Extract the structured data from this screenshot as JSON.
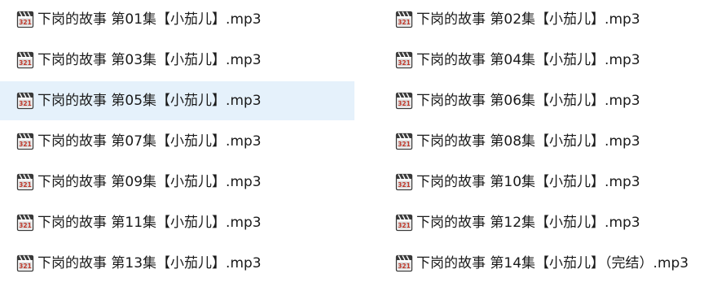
{
  "files": [
    {
      "name": "下岗的故事 第01集【小茄儿】.mp3",
      "icon": "media-file-icon",
      "selected": false
    },
    {
      "name": "下岗的故事 第02集【小茄儿】.mp3",
      "icon": "media-file-icon",
      "selected": false
    },
    {
      "name": "下岗的故事 第03集【小茄儿】.mp3",
      "icon": "media-file-icon",
      "selected": false
    },
    {
      "name": "下岗的故事 第04集【小茄儿】.mp3",
      "icon": "media-file-icon",
      "selected": false
    },
    {
      "name": "下岗的故事 第05集【小茄儿】.mp3",
      "icon": "media-file-icon",
      "selected": true
    },
    {
      "name": "下岗的故事 第06集【小茄儿】.mp3",
      "icon": "media-file-icon",
      "selected": false
    },
    {
      "name": "下岗的故事 第07集【小茄儿】.mp3",
      "icon": "media-file-icon",
      "selected": false
    },
    {
      "name": "下岗的故事 第08集【小茄儿】.mp3",
      "icon": "media-file-icon",
      "selected": false
    },
    {
      "name": "下岗的故事 第09集【小茄儿】.mp3",
      "icon": "media-file-icon",
      "selected": false
    },
    {
      "name": "下岗的故事 第10集【小茄儿】.mp3",
      "icon": "media-file-icon",
      "selected": false
    },
    {
      "name": "下岗的故事 第11集【小茄儿】.mp3",
      "icon": "media-file-icon",
      "selected": false
    },
    {
      "name": "下岗的故事 第12集【小茄儿】.mp3",
      "icon": "media-file-icon",
      "selected": false
    },
    {
      "name": "下岗的故事 第13集【小茄儿】.mp3",
      "icon": "media-file-icon",
      "selected": false
    },
    {
      "name": "下岗的故事 第14集【小茄儿】（完结）.mp3",
      "icon": "media-file-icon",
      "selected": false
    }
  ],
  "colors": {
    "selection_bg": "#e5f1fb",
    "icon_frame": "#3a3a3a",
    "icon_screen": "#ffffff",
    "icon_digits_bg": "#d9d9d9"
  }
}
